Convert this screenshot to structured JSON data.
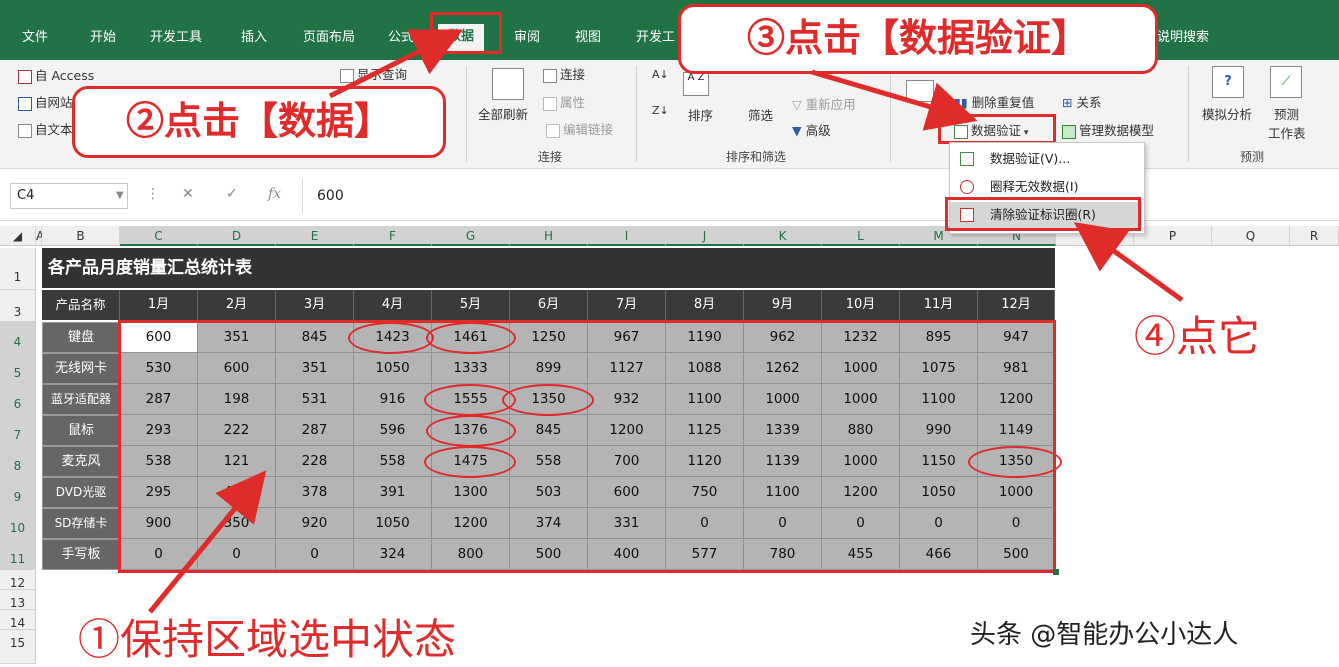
{
  "tabs": [
    "文件",
    "开始",
    "开发工具",
    "插入",
    "页面布局",
    "公式",
    "数据",
    "审阅",
    "视图",
    "开发工",
    "说明搜索"
  ],
  "active_tab": "数据",
  "ribbon": {
    "get_external": [
      "自 Access",
      "自网站",
      "自文本"
    ],
    "show_query": "显示查询",
    "refresh_all": "全部刷新",
    "connections": "连接",
    "properties": "属性",
    "edit_links": "编辑链接",
    "group_connections": "连接",
    "sort": "排序",
    "filter": "筛选",
    "reapply": "重新应用",
    "advanced": "高级",
    "group_sort_filter": "排序和筛选",
    "remove_duplicates": "删除重复值",
    "relationships": "关系",
    "data_validation": "数据验证",
    "manage_model": "管理数据模型",
    "what_if": "模拟分析",
    "forecast_sheet": "预测\n工作表",
    "forecast_sheet_l1": "预测",
    "forecast_sheet_l2": "工作表",
    "group_forecast": "预测"
  },
  "dropdown": {
    "items": [
      "数据验证(V)...",
      "圈释无效数据(I)",
      "清除验证标识圈(R)"
    ]
  },
  "formula_bar": {
    "name_box": "C4",
    "value": "600"
  },
  "columns": [
    "A",
    "B",
    "C",
    "D",
    "E",
    "F",
    "G",
    "H",
    "I",
    "J",
    "K",
    "L",
    "M",
    "N",
    "O",
    "P",
    "Q",
    "R"
  ],
  "rows": [
    "1",
    "3",
    "4",
    "5",
    "6",
    "7",
    "8",
    "9",
    "10",
    "11",
    "12",
    "13",
    "14",
    "15"
  ],
  "sheet": {
    "title": "各产品月度销量汇总统计表",
    "header": [
      "产品名称",
      "1月",
      "2月",
      "3月",
      "4月",
      "5月",
      "6月",
      "7月",
      "8月",
      "9月",
      "10月",
      "11月",
      "12月"
    ],
    "data": [
      {
        "name": "键盘",
        "values": [
          "600",
          "351",
          "845",
          "1423",
          "1461",
          "1250",
          "967",
          "1190",
          "962",
          "1232",
          "895",
          "947"
        ]
      },
      {
        "name": "无线网卡",
        "values": [
          "530",
          "600",
          "351",
          "1050",
          "1333",
          "899",
          "1127",
          "1088",
          "1262",
          "1000",
          "1075",
          "981"
        ]
      },
      {
        "name": "蓝牙适配器",
        "values": [
          "287",
          "198",
          "531",
          "916",
          "1555",
          "1350",
          "932",
          "1100",
          "1000",
          "1000",
          "1100",
          "1200"
        ]
      },
      {
        "name": "鼠标",
        "values": [
          "293",
          "222",
          "287",
          "596",
          "1376",
          "845",
          "1200",
          "1125",
          "1339",
          "880",
          "990",
          "1149"
        ]
      },
      {
        "name": "麦克风",
        "values": [
          "538",
          "121",
          "228",
          "558",
          "1475",
          "558",
          "700",
          "1120",
          "1139",
          "1000",
          "1150",
          "1350"
        ]
      },
      {
        "name": "DVD光驱",
        "values": [
          "295",
          "400",
          "378",
          "391",
          "1300",
          "503",
          "600",
          "750",
          "1100",
          "1200",
          "1050",
          "1000"
        ]
      },
      {
        "name": "SD存储卡",
        "values": [
          "900",
          "350",
          "920",
          "1050",
          "1200",
          "374",
          "331",
          "0",
          "0",
          "0",
          "0",
          "0"
        ]
      },
      {
        "name": "手写板",
        "values": [
          "0",
          "0",
          "0",
          "324",
          "800",
          "500",
          "400",
          "577",
          "780",
          "455",
          "466",
          "500"
        ]
      }
    ]
  },
  "annotations": {
    "step1": "①保持区域选中状态",
    "step2": "②点击【数据】",
    "step3": "③点击【数据验证】",
    "step4": "④点它"
  },
  "watermark": "头条 @智能办公小达人",
  "colors": {
    "excel_green": "#217346",
    "annotation_red": "#e02b2b"
  }
}
